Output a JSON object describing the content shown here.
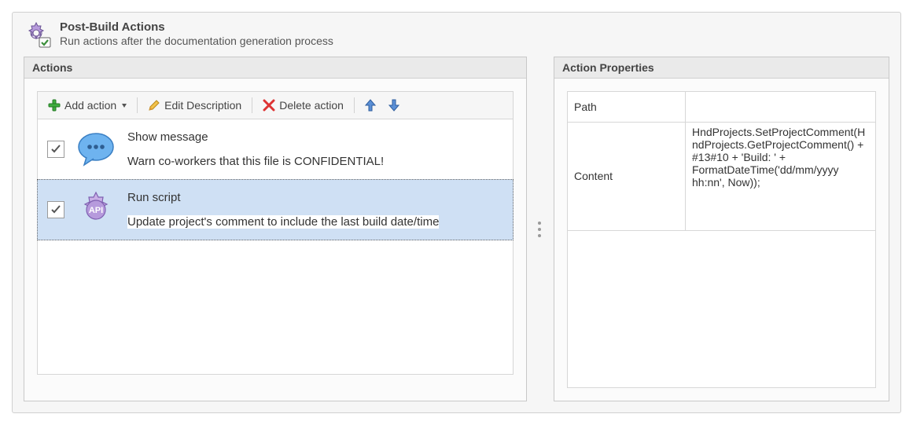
{
  "header": {
    "title": "Post-Build Actions",
    "subtitle": "Run actions after the documentation generation process"
  },
  "panels": {
    "actions_title": "Actions",
    "properties_title": "Action Properties"
  },
  "toolbar": {
    "add_label": "Add action",
    "edit_label": "Edit Description",
    "delete_label": "Delete action"
  },
  "actions": [
    {
      "checked": true,
      "selected": false,
      "icon": "speech-dots",
      "title": "Show message",
      "description": "Warn co-workers that this file is CONFIDENTIAL!"
    },
    {
      "checked": true,
      "selected": true,
      "icon": "api-gear",
      "title": "Run script",
      "description": "Update project's comment to include the last build date/time"
    }
  ],
  "properties": [
    {
      "key": "Path",
      "value": ""
    },
    {
      "key": "Content",
      "value": "HndProjects.SetProjectComment(HndProjects.GetProjectComment() + #13#10 + 'Build: ' + FormatDateTime('dd/mm/yyyy hh:nn', Now));"
    }
  ]
}
